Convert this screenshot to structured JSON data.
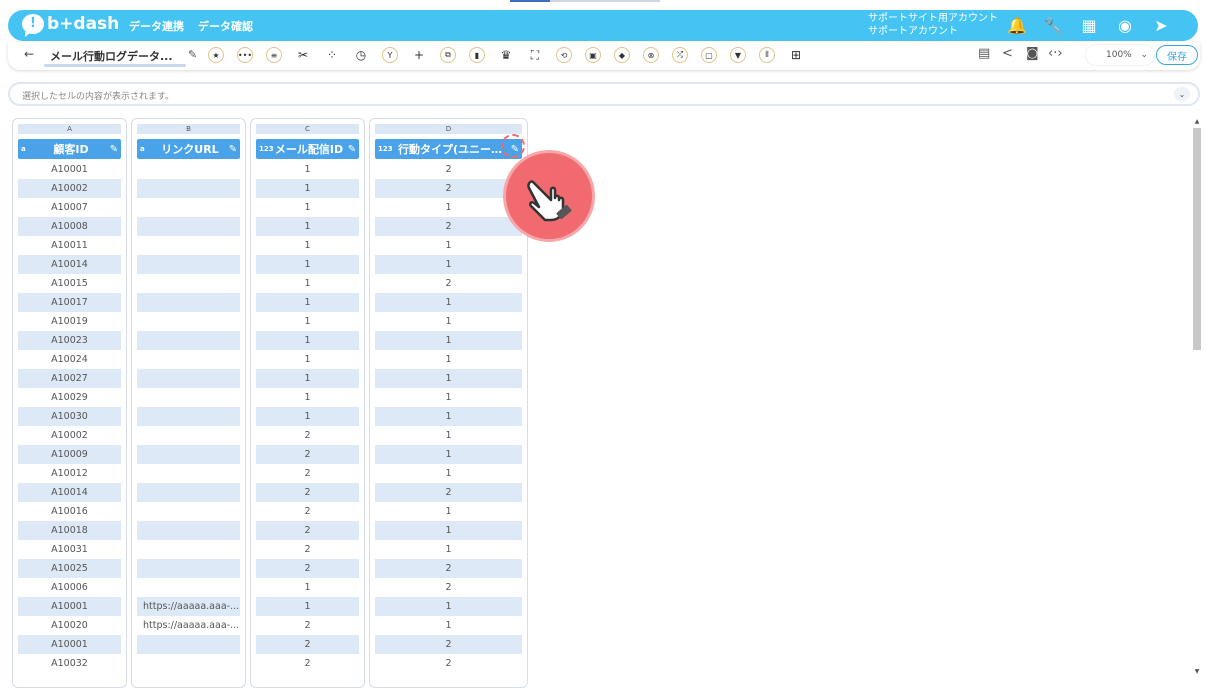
{
  "app": {
    "logo_text": "b+dash",
    "nav": [
      "データ連携",
      "データ確認"
    ],
    "account_line1": "サポートサイト用アカウント",
    "account_line2": "サポートアカウント",
    "icons": [
      "bell-icon",
      "wrench-icon",
      "apps-grid-icon",
      "chat-icon",
      "logout-icon"
    ]
  },
  "toolbar": {
    "back": "←",
    "title": "メール行動ログデータ...",
    "zoom": "100%",
    "save": "保存"
  },
  "cellbar": {
    "placeholder": "選択したセルの内容が表示されます。"
  },
  "grid": {
    "columns": [
      {
        "letter": "A",
        "type": "a",
        "name": "顧客ID"
      },
      {
        "letter": "B",
        "type": "a",
        "name": "リンクURL"
      },
      {
        "letter": "C",
        "type": "123",
        "name": "メール配信ID"
      },
      {
        "letter": "D",
        "type": "123",
        "name": "行動タイプ(ユニー…"
      }
    ],
    "rows": [
      [
        "A10001",
        "",
        "1",
        "2"
      ],
      [
        "A10002",
        "",
        "1",
        "2"
      ],
      [
        "A10007",
        "",
        "1",
        "1"
      ],
      [
        "A10008",
        "",
        "1",
        "2"
      ],
      [
        "A10011",
        "",
        "1",
        "1"
      ],
      [
        "A10014",
        "",
        "1",
        "1"
      ],
      [
        "A10015",
        "",
        "1",
        "2"
      ],
      [
        "A10017",
        "",
        "1",
        "1"
      ],
      [
        "A10019",
        "",
        "1",
        "1"
      ],
      [
        "A10023",
        "",
        "1",
        "1"
      ],
      [
        "A10024",
        "",
        "1",
        "1"
      ],
      [
        "A10027",
        "",
        "1",
        "1"
      ],
      [
        "A10029",
        "",
        "1",
        "1"
      ],
      [
        "A10030",
        "",
        "1",
        "1"
      ],
      [
        "A10002",
        "",
        "2",
        "1"
      ],
      [
        "A10009",
        "",
        "2",
        "1"
      ],
      [
        "A10012",
        "",
        "2",
        "1"
      ],
      [
        "A10014",
        "",
        "2",
        "2"
      ],
      [
        "A10016",
        "",
        "2",
        "1"
      ],
      [
        "A10018",
        "",
        "2",
        "1"
      ],
      [
        "A10031",
        "",
        "2",
        "1"
      ],
      [
        "A10025",
        "",
        "2",
        "2"
      ],
      [
        "A10006",
        "",
        "1",
        "2"
      ],
      [
        "A10001",
        "https://aaaaa.aaa-...",
        "1",
        "1"
      ],
      [
        "A10020",
        "https://aaaaa.aaa-...",
        "2",
        "1"
      ],
      [
        "A10001",
        "",
        "2",
        "2"
      ],
      [
        "A10032",
        "",
        "2",
        "2"
      ]
    ]
  },
  "colors": {
    "appbar": "#45c4f3",
    "header": "#4aa3e8",
    "alt_row": "#dde9f6",
    "pointer": "#f06a6f"
  }
}
